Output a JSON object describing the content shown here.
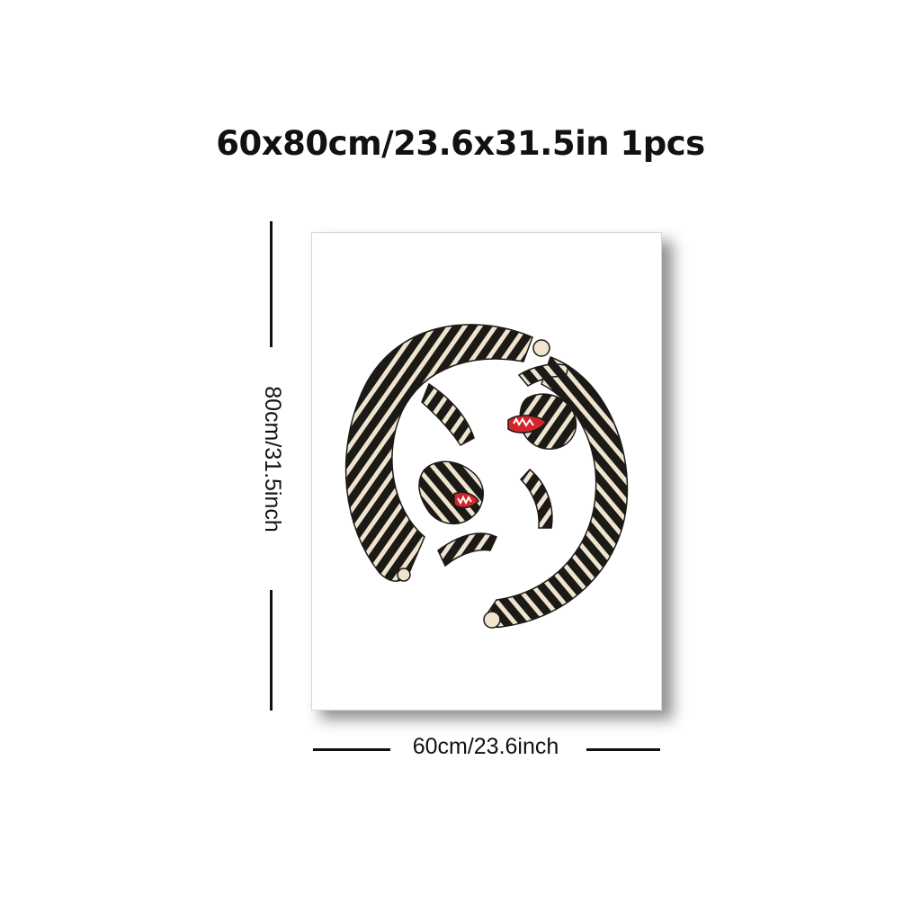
{
  "header": {
    "title": "60x80cm/23.6x31.5in 1pcs"
  },
  "dimensions": {
    "height_label": "80cm/31.5inch",
    "width_label": "60cm/23.6inch"
  },
  "product": {
    "artwork_subject": "tiger-pair-circle"
  },
  "colors": {
    "stripe_dark": "#1c1a17",
    "stripe_light": "#efe4cf",
    "mouth_red": "#d2262a"
  }
}
